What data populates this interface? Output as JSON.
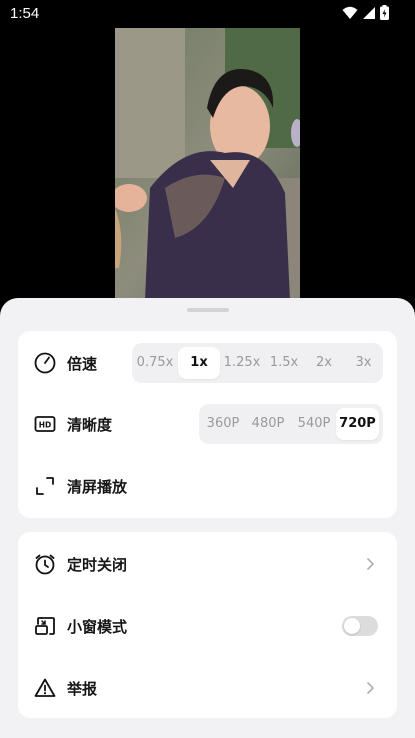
{
  "status_bar": {
    "time": "1:54"
  },
  "speed": {
    "label": "倍速",
    "options": [
      "0.75x",
      "1x",
      "1.25x",
      "1.5x",
      "2x",
      "3x"
    ],
    "selected": "1x"
  },
  "quality": {
    "label": "清晰度",
    "options": [
      "360P",
      "480P",
      "540P",
      "720P"
    ],
    "selected": "720P"
  },
  "clear_screen": {
    "label": "清屏播放"
  },
  "timer": {
    "label": "定时关闭"
  },
  "mini_window": {
    "label": "小窗模式",
    "enabled": false
  },
  "report": {
    "label": "举报"
  }
}
